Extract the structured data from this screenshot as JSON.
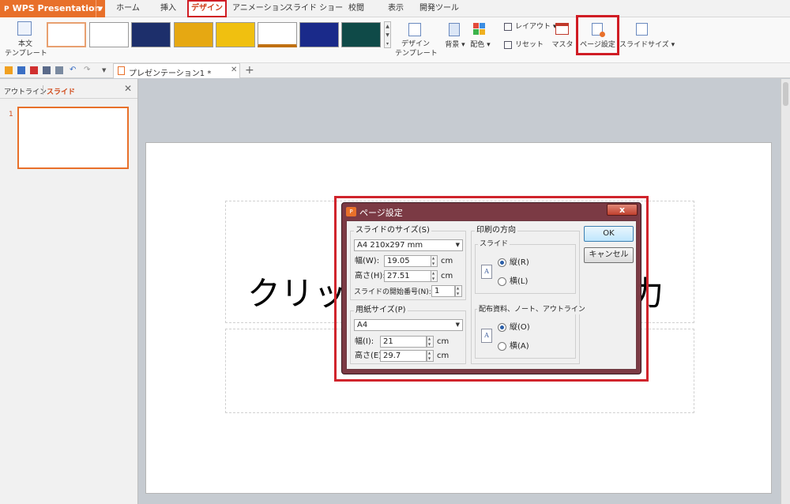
{
  "app": {
    "name": "WPS Presentation"
  },
  "menu_tabs": [
    "ホーム",
    "挿入",
    "デザイン",
    "アニメーション",
    "スライド ショー",
    "校閲",
    "表示",
    "開発ツール"
  ],
  "ribbon": {
    "template_label_line1": "本文",
    "template_label_line2": "テンプレート",
    "design_template_line1": "デザイン",
    "design_template_line2": "テンプレート",
    "background": "背景",
    "color": "配色",
    "layout": "レイアウト",
    "reset": "リセット",
    "master": "マスタ",
    "page_setup": "ページ設定",
    "slide_size": "スライドサイズ"
  },
  "doc_tab": {
    "title": "プレゼンテーション1 *"
  },
  "left_panel": {
    "tab_outline": "アウトライン",
    "tab_slide": "スライド",
    "slide_number": "1"
  },
  "slide": {
    "title_visible_left": "クリッ",
    "title_visible_right": "力"
  },
  "dialog": {
    "title": "ページ設定",
    "slide_size_label": "スライドのサイズ(S)",
    "slide_size_value": "A4 210x297 mm",
    "width_label": "幅(W):",
    "width_value": "19.05",
    "height_label": "高さ(H):",
    "height_value": "27.51",
    "unit_cm": "cm",
    "start_number_label": "スライドの開始番号(N):",
    "start_number_value": "1",
    "paper_size_label": "用紙サイズ(P)",
    "paper_size_value": "A4",
    "paper_width_label": "幅(I):",
    "paper_width_value": "21",
    "paper_height_label": "高さ(E)",
    "paper_height_value": "29.7",
    "orientation_label": "印刷の方向",
    "slide_group_label": "スライド",
    "portrait_r": "縦(R)",
    "landscape_l": "横(L)",
    "handout_group_label": "配布資料、ノート、アウトライン",
    "portrait_o": "縦(O)",
    "landscape_a": "横(A)",
    "ok": "OK",
    "cancel": "キャンセル",
    "close_glyph": "x",
    "doc_glyph": "A"
  },
  "colors": {
    "accent": "#e8702a",
    "highlight": "#d01c24"
  }
}
